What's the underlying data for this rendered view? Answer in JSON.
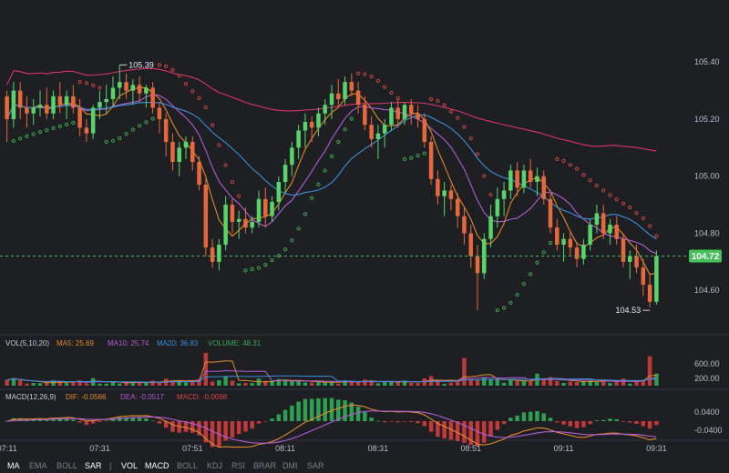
{
  "chart_data": {
    "type": "candlestick",
    "main": {
      "price_ticks": [
        105.4,
        105.2,
        105.0,
        104.8,
        104.6
      ],
      "price_tick_labels": [
        "105.40",
        "105.20",
        "105.00",
        "104.80",
        "104.60"
      ],
      "price_range": [
        104.47,
        105.56
      ],
      "last_price": 104.72,
      "last_price_label": "104.72",
      "high_annotation": {
        "value": 105.39,
        "label": "105.39",
        "index": 17
      },
      "low_annotation": {
        "value": 104.53,
        "label": "104.53",
        "index": 97
      },
      "overlays": [
        "MA",
        "SAR"
      ],
      "candles": [
        [
          105.28,
          105.3,
          105.12,
          105.2
        ],
        [
          105.2,
          105.33,
          105.17,
          105.3
        ],
        [
          105.3,
          105.33,
          105.2,
          105.24
        ],
        [
          105.24,
          105.28,
          105.17,
          105.22
        ],
        [
          105.22,
          105.27,
          105.18,
          105.24
        ],
        [
          105.24,
          105.3,
          105.21,
          105.25
        ],
        [
          105.25,
          105.31,
          105.2,
          105.22
        ],
        [
          105.22,
          105.3,
          105.2,
          105.28
        ],
        [
          105.28,
          105.33,
          105.22,
          105.25
        ],
        [
          105.25,
          105.3,
          105.2,
          105.28
        ],
        [
          105.28,
          105.32,
          105.22,
          105.24
        ],
        [
          105.24,
          105.27,
          105.14,
          105.17
        ],
        [
          105.17,
          105.2,
          105.12,
          105.15
        ],
        [
          105.15,
          105.25,
          105.13,
          105.24
        ],
        [
          105.24,
          105.3,
          105.2,
          105.26
        ],
        [
          105.26,
          105.32,
          105.22,
          105.27
        ],
        [
          105.27,
          105.35,
          105.24,
          105.31
        ],
        [
          105.31,
          105.39,
          105.27,
          105.33
        ],
        [
          105.33,
          105.36,
          105.27,
          105.3
        ],
        [
          105.3,
          105.34,
          105.25,
          105.32
        ],
        [
          105.32,
          105.35,
          105.26,
          105.29
        ],
        [
          105.29,
          105.32,
          105.24,
          105.31
        ],
        [
          105.31,
          105.33,
          105.22,
          105.24
        ],
        [
          105.24,
          105.26,
          105.15,
          105.2
        ],
        [
          105.2,
          105.22,
          105.07,
          105.12
        ],
        [
          105.12,
          105.15,
          105.02,
          105.05
        ],
        [
          105.05,
          105.12,
          105.0,
          105.1
        ],
        [
          105.1,
          105.14,
          105.06,
          105.12
        ],
        [
          105.12,
          105.14,
          105.02,
          105.05
        ],
        [
          105.05,
          105.07,
          104.95,
          104.97
        ],
        [
          104.97,
          104.99,
          104.72,
          104.75
        ],
        [
          104.75,
          104.78,
          104.68,
          104.7
        ],
        [
          104.7,
          104.78,
          104.67,
          104.76
        ],
        [
          104.76,
          104.93,
          104.74,
          104.9
        ],
        [
          104.9,
          104.92,
          104.8,
          104.84
        ],
        [
          104.84,
          104.88,
          104.78,
          104.85
        ],
        [
          104.85,
          104.89,
          104.8,
          104.82
        ],
        [
          104.82,
          104.86,
          104.8,
          104.84
        ],
        [
          104.84,
          104.95,
          104.82,
          104.92
        ],
        [
          104.92,
          104.96,
          104.82,
          104.86
        ],
        [
          104.86,
          104.93,
          104.84,
          104.91
        ],
        [
          104.91,
          105.0,
          104.88,
          104.98
        ],
        [
          104.98,
          105.06,
          104.94,
          105.04
        ],
        [
          105.04,
          105.12,
          105.0,
          105.1
        ],
        [
          105.1,
          105.18,
          105.06,
          105.16
        ],
        [
          105.16,
          105.22,
          105.1,
          105.19
        ],
        [
          105.19,
          105.21,
          105.12,
          105.17
        ],
        [
          105.17,
          105.24,
          105.14,
          105.22
        ],
        [
          105.22,
          105.27,
          105.18,
          105.25
        ],
        [
          105.25,
          105.32,
          105.2,
          105.29
        ],
        [
          105.29,
          105.34,
          105.24,
          105.27
        ],
        [
          105.27,
          105.35,
          105.25,
          105.33
        ],
        [
          105.33,
          105.36,
          105.28,
          105.3
        ],
        [
          105.3,
          105.33,
          105.22,
          105.25
        ],
        [
          105.25,
          105.28,
          105.16,
          105.18
        ],
        [
          105.18,
          105.21,
          105.1,
          105.13
        ],
        [
          105.13,
          105.18,
          105.06,
          105.15
        ],
        [
          105.15,
          105.2,
          105.1,
          105.18
        ],
        [
          105.18,
          105.26,
          105.16,
          105.24
        ],
        [
          105.24,
          105.27,
          105.17,
          105.2
        ],
        [
          105.2,
          105.26,
          105.18,
          105.25
        ],
        [
          105.25,
          105.27,
          105.18,
          105.22
        ],
        [
          105.22,
          105.25,
          105.17,
          105.2
        ],
        [
          105.2,
          105.22,
          105.1,
          105.12
        ],
        [
          105.12,
          105.14,
          104.97,
          104.99
        ],
        [
          104.99,
          105.02,
          104.9,
          104.93
        ],
        [
          104.93,
          104.98,
          104.86,
          104.95
        ],
        [
          104.95,
          104.97,
          104.88,
          104.92
        ],
        [
          104.92,
          104.94,
          104.82,
          104.86
        ],
        [
          104.86,
          104.89,
          104.76,
          104.8
        ],
        [
          104.8,
          104.83,
          104.68,
          104.72
        ],
        [
          104.72,
          104.76,
          104.53,
          104.66
        ],
        [
          104.66,
          104.8,
          104.64,
          104.78
        ],
        [
          104.78,
          104.9,
          104.75,
          104.86
        ],
        [
          104.86,
          104.96,
          104.82,
          104.92
        ],
        [
          104.92,
          104.98,
          104.86,
          104.95
        ],
        [
          104.95,
          105.04,
          104.92,
          105.02
        ],
        [
          105.02,
          105.05,
          104.93,
          104.96
        ],
        [
          104.96,
          105.04,
          104.94,
          105.02
        ],
        [
          105.02,
          105.06,
          104.96,
          104.98
        ],
        [
          104.98,
          105.03,
          104.93,
          105.0
        ],
        [
          105.0,
          105.02,
          104.9,
          104.92
        ],
        [
          104.92,
          104.94,
          104.8,
          104.82
        ],
        [
          104.82,
          104.85,
          104.74,
          104.76
        ],
        [
          104.76,
          104.8,
          104.7,
          104.78
        ],
        [
          104.78,
          104.81,
          104.72,
          104.75
        ],
        [
          104.75,
          104.77,
          104.68,
          104.71
        ],
        [
          104.71,
          104.78,
          104.69,
          104.76
        ],
        [
          104.76,
          104.85,
          104.74,
          104.83
        ],
        [
          104.83,
          104.9,
          104.8,
          104.87
        ],
        [
          104.87,
          104.9,
          104.78,
          104.8
        ],
        [
          104.8,
          104.85,
          104.76,
          104.83
        ],
        [
          104.83,
          104.86,
          104.76,
          104.78
        ],
        [
          104.78,
          104.8,
          104.68,
          104.7
        ],
        [
          104.7,
          104.74,
          104.64,
          104.72
        ],
        [
          104.72,
          104.76,
          104.66,
          104.68
        ],
        [
          104.68,
          104.71,
          104.58,
          104.62
        ],
        [
          104.62,
          104.66,
          104.54,
          104.56
        ],
        [
          104.56,
          104.74,
          104.55,
          104.72
        ]
      ],
      "ma_lines": [
        {
          "name": "MA5",
          "color": "#e08a28"
        },
        {
          "name": "MA10",
          "color": "#b05cd6"
        },
        {
          "name": "MA20",
          "color": "#3a8fd8"
        },
        {
          "name": "MA60",
          "color": "#d8346a"
        }
      ],
      "sar_color": "#3ea84f",
      "sar_color_down": "#c9473f"
    },
    "volume": {
      "header": "VOL(5,10,20)",
      "ma5_label": "MA5: 25.69",
      "ma10_label": "MA10: 25.74",
      "ma20_label": "MA20: 36.83",
      "volume_label": "VOLUME: 48.31",
      "ticks": [
        600,
        200
      ],
      "tick_labels": [
        "600.00",
        "200.00"
      ],
      "range": [
        0,
        900
      ]
    },
    "macd": {
      "header": "MACD(12,26,9)",
      "dif_label": "DIF: -0.0566",
      "dea_label": "DEA: -0.0517",
      "macd_label": "MACD: -0.0098",
      "ticks": [
        0.04,
        -0.04
      ],
      "tick_labels": [
        "0.0400",
        "-0.0400"
      ],
      "range": [
        -0.075,
        0.075
      ]
    },
    "time_labels": [
      "07:11",
      "07:31",
      "07:51",
      "08:11",
      "08:31",
      "08:51",
      "09:11",
      "09:31"
    ]
  },
  "indicator_bar": {
    "main_items": [
      "MA",
      "EMA",
      "BOLL",
      "SAR"
    ],
    "separator": "|",
    "sub_items": [
      "VOL",
      "MACD",
      "BOLL",
      "KDJ",
      "RSI",
      "BRAR",
      "DMI",
      "SAR"
    ],
    "active": [
      "MA",
      "SAR",
      "VOL",
      "MACD"
    ]
  },
  "colors": {
    "up": "#59d36b",
    "down": "#e8683e",
    "background": "#1e1f23",
    "last_price_badge": "#45c05a",
    "dif": "#e08a28",
    "dea": "#b05cd6",
    "macd_hist_up": "#2e9e52",
    "macd_hist_down": "#c2393b"
  }
}
